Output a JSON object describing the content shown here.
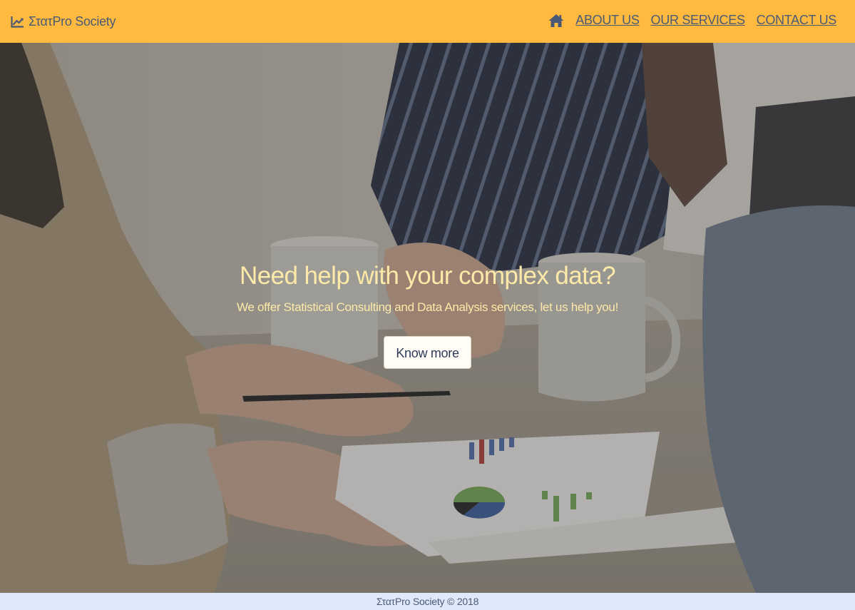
{
  "colors": {
    "nav_background": "#ffba3f",
    "nav_text": "#4a5a75",
    "hero_text": "#fde9a8",
    "button_background": "#fffdf6",
    "button_text": "#2e3a57",
    "footer_background": "#dfe9fa"
  },
  "navbar": {
    "brand": {
      "icon": "line-chart-icon",
      "name": "ΣτατPro Society"
    },
    "home_icon": "home-icon",
    "links": [
      {
        "label": "ABOUT US"
      },
      {
        "label": "OUR SERVICES"
      },
      {
        "label": "CONTACT US"
      }
    ]
  },
  "hero": {
    "background": "office-meeting-photo",
    "title": "Need help with your complex data?",
    "subtitle": "We offer Statistical Consulting and Data Analysis services, let us help you!",
    "button_label": "Know more"
  },
  "footer": {
    "text": "ΣτατPro Society © 2018"
  }
}
